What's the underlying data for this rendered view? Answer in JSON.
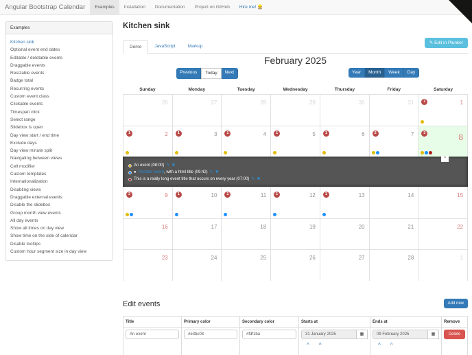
{
  "nav": {
    "brand": "Angular Bootstrap Calendar",
    "items": [
      "Examples",
      "Installation",
      "Documentation",
      "Project on GitHub",
      "Hire me! 👷"
    ]
  },
  "sidebar": {
    "title": "Examples",
    "items": [
      "Kitchen sink",
      "Optional event end dates",
      "Editable / deletable events",
      "Draggable events",
      "Resizable events",
      "Badge total",
      "Recurring events",
      "Custom event class",
      "Clickable events",
      "Timespan click",
      "Select range",
      "Slidebox is open",
      "Day view start / end time",
      "Exclude days",
      "Day view minute split",
      "Navigating between views",
      "Cell modifier",
      "Custom templates",
      "Internationalization",
      "Disabling views",
      "Draggable external events",
      "Disable the slidebox",
      "Group month view events",
      "All day events",
      "Show all times on day view",
      "Show time on the side of calendar",
      "Disable tooltips",
      "Custom hour segment size in day view"
    ]
  },
  "main": {
    "title": "Kitchen sink",
    "tabs": [
      "Demo",
      "JavaScript",
      "Markup"
    ],
    "plunker": "Edit in Plunker",
    "calendar_title": "February 2025",
    "nav_buttons": [
      "Previous",
      "Today",
      "Next"
    ],
    "view_buttons": [
      "Year",
      "Month",
      "Week",
      "Day"
    ],
    "weekdays": [
      "Sunday",
      "Monday",
      "Tuesday",
      "Wednesday",
      "Thursday",
      "Friday",
      "Saturday"
    ]
  },
  "colors": {
    "yellow": "#e3bc08",
    "blue": "#1e90ff",
    "red": "#ad2121"
  },
  "weeks": [
    [
      {
        "d": 26,
        "out": 1
      },
      {
        "d": 27,
        "out": 1
      },
      {
        "d": 28,
        "out": 1
      },
      {
        "d": 29,
        "out": 1
      },
      {
        "d": 30,
        "out": 1
      },
      {
        "d": 31,
        "out": 1
      },
      {
        "d": 1,
        "b": 1,
        "dots": [
          "yellow"
        ]
      }
    ],
    [
      {
        "d": 2,
        "b": 1,
        "dots": [
          "yellow"
        ]
      },
      {
        "d": 3,
        "b": 1,
        "dots": [
          "yellow"
        ]
      },
      {
        "d": 4,
        "b": 1,
        "dots": [
          "yellow"
        ]
      },
      {
        "d": 5,
        "b": 1,
        "dots": [
          "yellow"
        ]
      },
      {
        "d": 6,
        "b": 1,
        "dots": [
          "yellow"
        ]
      },
      {
        "d": 7,
        "b": 2,
        "dots": [
          "yellow",
          "blue"
        ]
      },
      {
        "d": 8,
        "b": 3,
        "today": 1,
        "dots": [
          "yellow",
          "blue",
          "red"
        ]
      }
    ],
    [
      {
        "d": 9,
        "b": 2,
        "dots": [
          "yellow",
          "blue"
        ]
      },
      {
        "d": 10,
        "b": 1,
        "dots": [
          "blue"
        ]
      },
      {
        "d": 11,
        "b": 1,
        "dots": [
          "blue"
        ]
      },
      {
        "d": 12,
        "b": 1,
        "dots": [
          "blue"
        ]
      },
      {
        "d": 13,
        "b": 1,
        "dots": [
          "blue"
        ]
      },
      {
        "d": 14
      },
      {
        "d": 15
      }
    ],
    [
      {
        "d": 16
      },
      {
        "d": 17
      },
      {
        "d": 18
      },
      {
        "d": 19
      },
      {
        "d": 20
      },
      {
        "d": 21
      },
      {
        "d": 22
      }
    ],
    [
      {
        "d": 23
      },
      {
        "d": 24
      },
      {
        "d": 25
      },
      {
        "d": 26
      },
      {
        "d": 27
      },
      {
        "d": 28
      },
      {
        "d": 1,
        "out": 1
      }
    ]
  ],
  "open_events": [
    {
      "color": "yellow",
      "pre": "",
      "link": "",
      "text": "An event (08:00)"
    },
    {
      "color": "blue",
      "pre": "●",
      "link": "Another event",
      "text": ", with a html title (09:42)"
    },
    {
      "color": "red",
      "pre": "",
      "link": "",
      "text": "This is a really long event title that occurs on every year (07:00)"
    }
  ],
  "edit": {
    "title": "Edit events",
    "add": "Add new",
    "headers": [
      "Title",
      "Primary color",
      "Secondary color",
      "Starts at",
      "Ends at",
      "Remove"
    ],
    "row": {
      "title": "An event",
      "primary": "#e3bc08",
      "secondary": "#fdf1ba",
      "start": "31 January 2025",
      "end": "09 February 2025",
      "delete": "Delete"
    }
  }
}
